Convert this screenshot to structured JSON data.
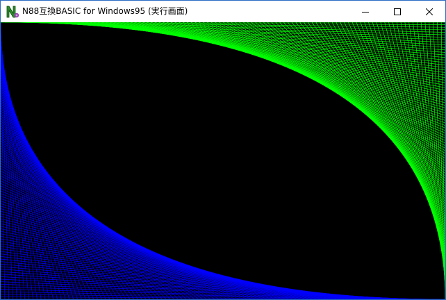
{
  "window": {
    "title": "N88互換BASIC for Windows95 (実行画面)",
    "app_icon": "n88-basic-app-icon",
    "controls": {
      "minimize": "minimize-icon",
      "maximize": "maximize-icon",
      "close": "close-icon"
    }
  },
  "canvas": {
    "background_color": "#000000",
    "colors": {
      "blue_lines": "#0000ff",
      "green_lines": "#00ff00"
    }
  }
}
